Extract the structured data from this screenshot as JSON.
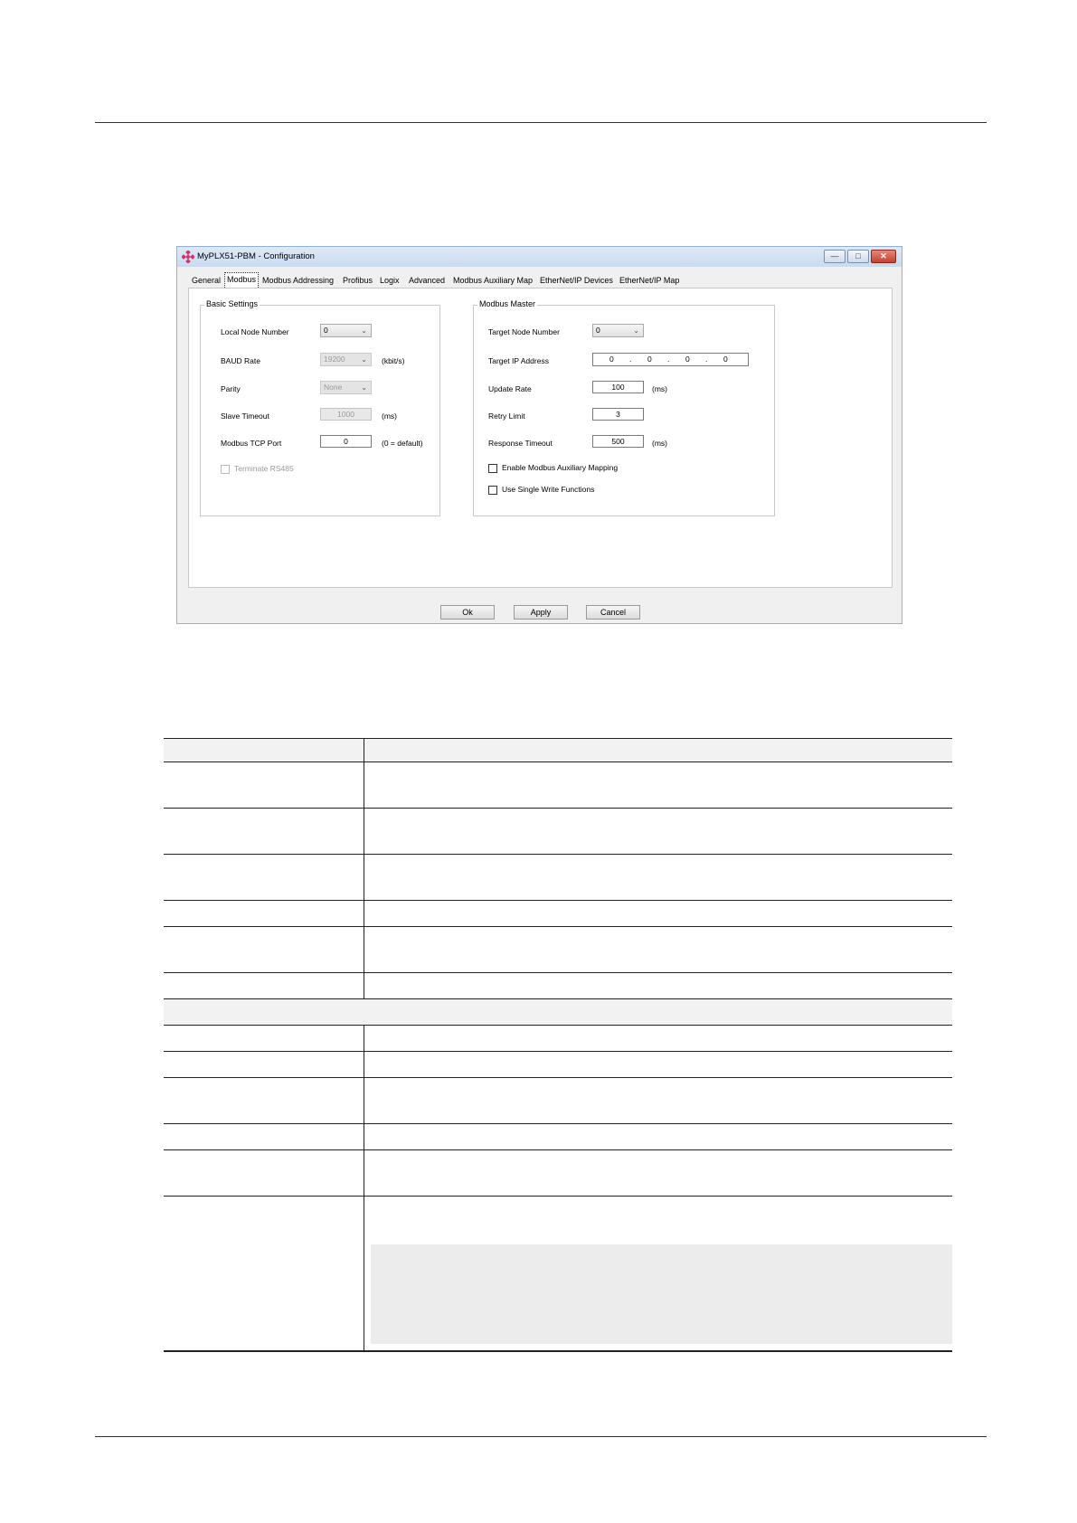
{
  "window": {
    "title": "MyPLX51-PBM - Configuration",
    "buttons": {
      "minimize": "—",
      "maximize": "□",
      "close": "✕"
    }
  },
  "tabs": [
    "General",
    "Modbus",
    "Modbus Addressing",
    "Profibus",
    "Logix",
    "Advanced",
    "Modbus Auxiliary Map",
    "EtherNet/IP Devices",
    "EtherNet/IP Map"
  ],
  "basic": {
    "title": "Basic Settings",
    "local_node_label": "Local Node Number",
    "local_node_value": "0",
    "baud_label": "BAUD Rate",
    "baud_value": "19200",
    "baud_unit": "(kbit/s)",
    "parity_label": "Parity",
    "parity_value": "None",
    "slave_timeout_label": "Slave Timeout",
    "slave_timeout_value": "1000",
    "slave_timeout_unit": "(ms)",
    "tcp_port_label": "Modbus TCP Port",
    "tcp_port_value": "0",
    "tcp_port_unit": "(0 = default)",
    "terminate_label": "Terminate RS485"
  },
  "master": {
    "title": "Modbus Master",
    "target_node_label": "Target Node Number",
    "target_node_value": "0",
    "target_ip_label": "Target IP Address",
    "ip": [
      "0",
      "0",
      "0",
      "0"
    ],
    "ip_sep": ".",
    "update_rate_label": "Update Rate",
    "update_rate_value": "100",
    "update_rate_unit": "(ms)",
    "retry_label": "Retry Limit",
    "retry_value": "3",
    "response_label": "Response Timeout",
    "response_value": "500",
    "response_unit": "(ms)",
    "aux_mapping_label": "Enable Modbus Auxiliary Mapping",
    "single_write_label": "Use Single Write Functions"
  },
  "footer_buttons": {
    "ok": "Ok",
    "apply": "Apply",
    "cancel": "Cancel"
  }
}
